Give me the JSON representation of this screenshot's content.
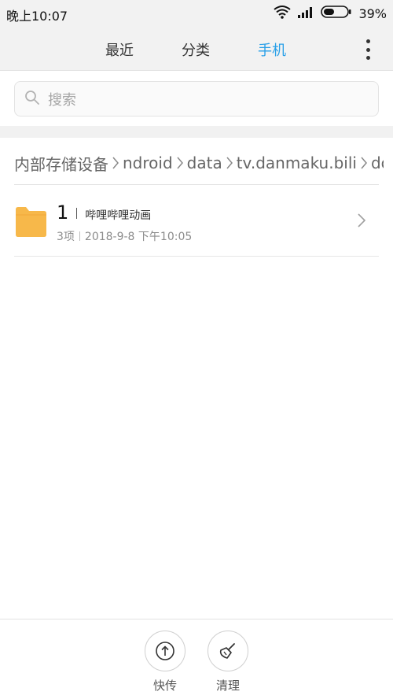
{
  "status_bar": {
    "time": "晚上10:07",
    "battery": "39%",
    "icons": [
      "wifi-icon",
      "signal-icon",
      "battery-icon"
    ]
  },
  "tabs": [
    {
      "label": "最近",
      "active": false
    },
    {
      "label": "分类",
      "active": false
    },
    {
      "label": "手机",
      "active": true
    }
  ],
  "header": {
    "more_icon": "more-vertical-icon"
  },
  "search": {
    "placeholder": "搜索",
    "icon": "search-icon"
  },
  "breadcrumb": [
    {
      "label": "内部存储设备"
    },
    {
      "label": "ndroid"
    },
    {
      "label": "data"
    },
    {
      "label": "tv.danmaku.bili"
    },
    {
      "label": "dowr"
    }
  ],
  "files": [
    {
      "name": "1",
      "tag": "哔哩哔哩动画",
      "count": "3项",
      "date": "2018-9-8 下午10:05",
      "icon": "folder-icon"
    }
  ],
  "bottom_bar": {
    "share": {
      "label": "快传",
      "icon": "upload-icon"
    },
    "clean": {
      "label": "清理",
      "icon": "broom-icon"
    }
  },
  "colors": {
    "accent": "#2aa0e8",
    "folder": "#f7b84a",
    "header_bg": "#f2f2f2"
  }
}
